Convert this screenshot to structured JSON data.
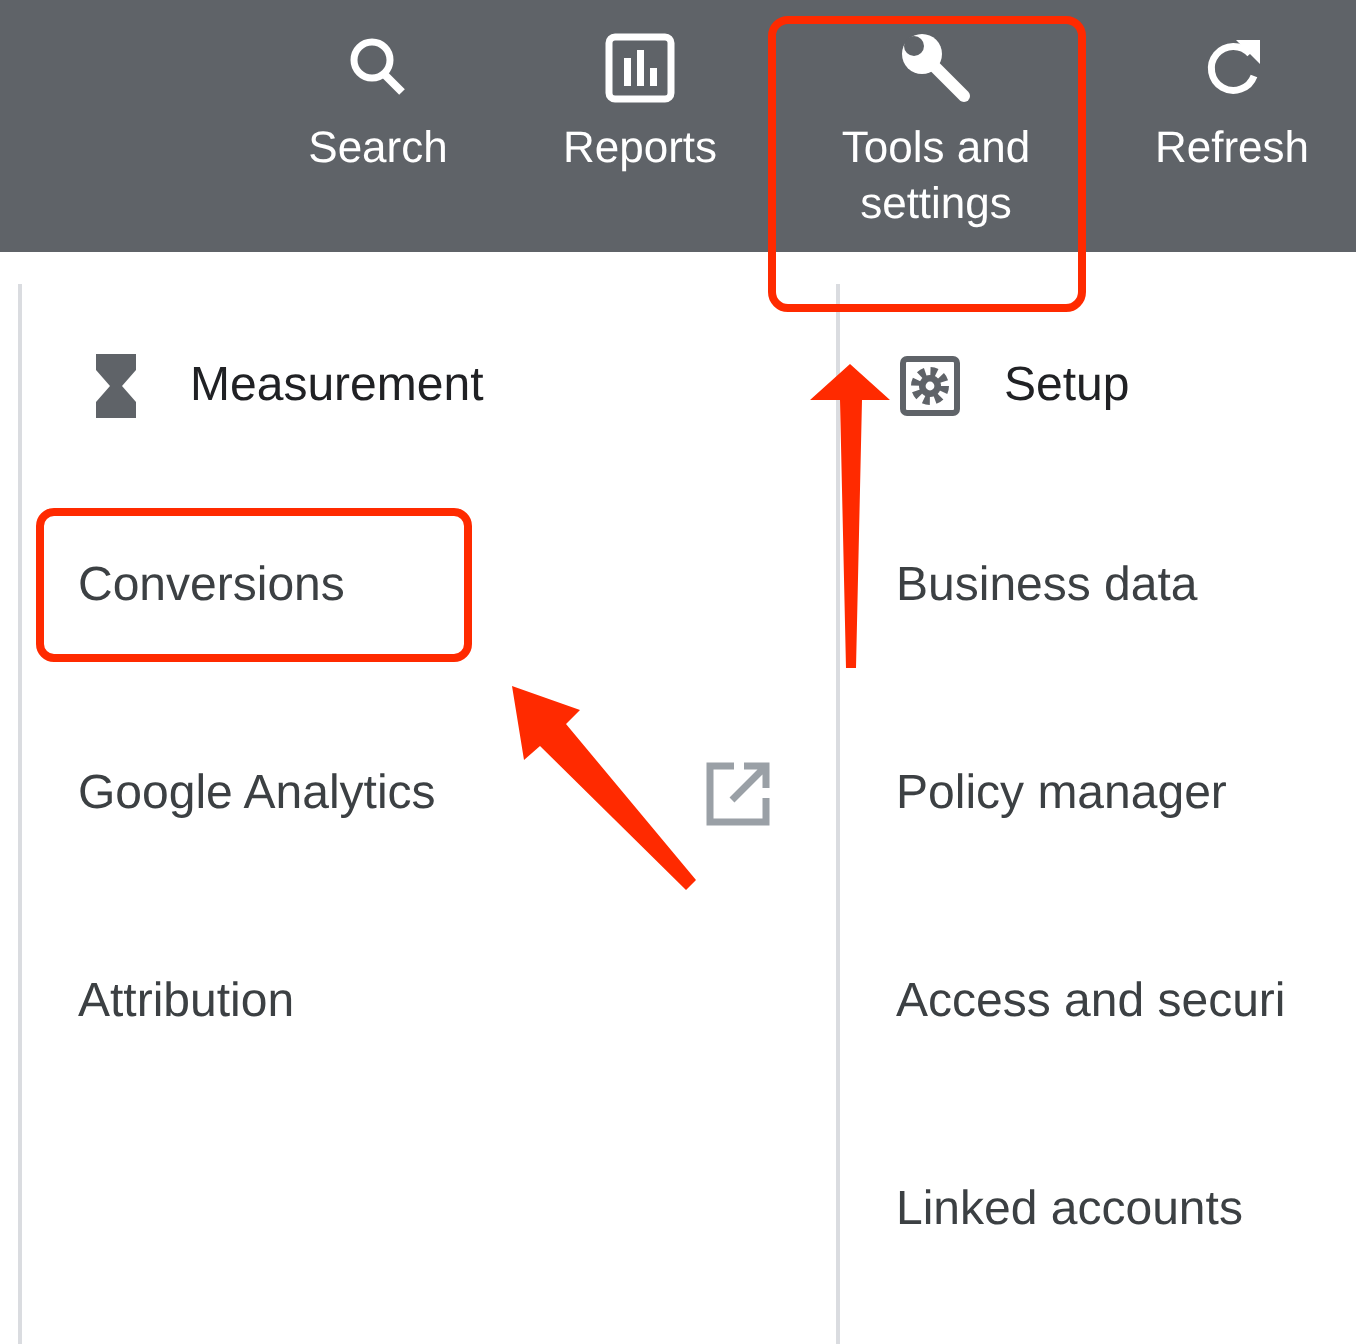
{
  "toolbar": [
    {
      "label": "Search",
      "kind": "search",
      "highlighted": false
    },
    {
      "label": "Reports",
      "kind": "reports",
      "highlighted": false
    },
    {
      "label": "Tools and settings",
      "kind": "tools",
      "highlighted": true
    },
    {
      "label": "Refresh",
      "kind": "refresh",
      "highlighted": false
    }
  ],
  "columns": [
    {
      "title": "Measurement",
      "kind": "measurement",
      "items": [
        {
          "label": "Conversions",
          "highlighted": true,
          "external": false
        },
        {
          "label": "Google Analytics",
          "highlighted": false,
          "external": true
        },
        {
          "label": "Attribution",
          "highlighted": false,
          "external": false
        }
      ]
    },
    {
      "title": "Setup",
      "kind": "setup",
      "items": [
        {
          "label": "Business data",
          "highlighted": false,
          "external": false
        },
        {
          "label": "Policy manager",
          "highlighted": false,
          "external": false
        },
        {
          "label": "Access and securi",
          "highlighted": false,
          "external": false
        },
        {
          "label": "Linked accounts",
          "highlighted": false,
          "external": false
        }
      ]
    }
  ]
}
